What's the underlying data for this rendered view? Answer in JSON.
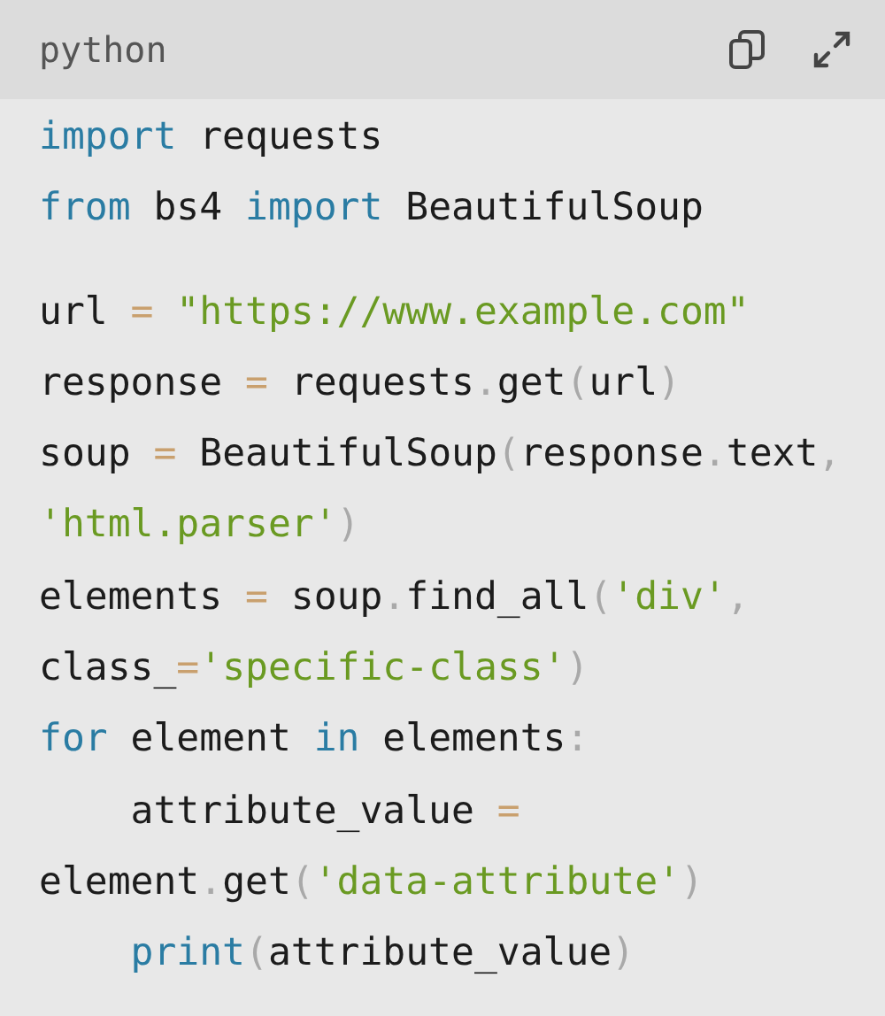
{
  "header": {
    "language": "python"
  },
  "code": {
    "blocks": [
      [
        [
          {
            "text": "import",
            "kind": "keyword"
          },
          {
            "text": " requests",
            "kind": "plain"
          }
        ],
        [
          {
            "text": "from",
            "kind": "keyword"
          },
          {
            "text": " bs4 ",
            "kind": "plain"
          },
          {
            "text": "import",
            "kind": "keyword"
          },
          {
            "text": " BeautifulSoup",
            "kind": "plain"
          }
        ]
      ],
      [
        [
          {
            "text": "url ",
            "kind": "plain"
          },
          {
            "text": "=",
            "kind": "operator"
          },
          {
            "text": " \"https://www.example.com\"",
            "kind": "string"
          }
        ],
        [
          {
            "text": "response ",
            "kind": "plain"
          },
          {
            "text": "=",
            "kind": "operator"
          },
          {
            "text": " requests",
            "kind": "plain"
          },
          {
            "text": ".",
            "kind": "punct"
          },
          {
            "text": "get",
            "kind": "plain"
          },
          {
            "text": "(",
            "kind": "punct"
          },
          {
            "text": "url",
            "kind": "plain"
          },
          {
            "text": ")",
            "kind": "punct"
          }
        ],
        [
          {
            "text": "soup ",
            "kind": "plain"
          },
          {
            "text": "=",
            "kind": "operator"
          },
          {
            "text": " BeautifulSoup",
            "kind": "plain"
          },
          {
            "text": "(",
            "kind": "punct"
          },
          {
            "text": "response",
            "kind": "plain"
          },
          {
            "text": ".",
            "kind": "punct"
          },
          {
            "text": "text",
            "kind": "plain"
          },
          {
            "text": ",",
            "kind": "punct"
          }
        ],
        [
          {
            "text": "'html.parser'",
            "kind": "string"
          },
          {
            "text": ")",
            "kind": "punct"
          }
        ],
        [
          {
            "text": "elements ",
            "kind": "plain"
          },
          {
            "text": "=",
            "kind": "operator"
          },
          {
            "text": " soup",
            "kind": "plain"
          },
          {
            "text": ".",
            "kind": "punct"
          },
          {
            "text": "find_all",
            "kind": "plain"
          },
          {
            "text": "(",
            "kind": "punct"
          },
          {
            "text": "'div'",
            "kind": "string"
          },
          {
            "text": ",",
            "kind": "punct"
          }
        ],
        [
          {
            "text": "class_",
            "kind": "plain"
          },
          {
            "text": "=",
            "kind": "operator"
          },
          {
            "text": "'specific-class'",
            "kind": "string"
          },
          {
            "text": ")",
            "kind": "punct"
          }
        ],
        [
          {
            "text": "for",
            "kind": "keyword"
          },
          {
            "text": " element ",
            "kind": "plain"
          },
          {
            "text": "in",
            "kind": "keyword"
          },
          {
            "text": " elements",
            "kind": "plain"
          },
          {
            "text": ":",
            "kind": "punct"
          }
        ],
        [
          {
            "text": "    attribute_value ",
            "kind": "plain"
          },
          {
            "text": "=",
            "kind": "operator"
          }
        ],
        [
          {
            "text": "element",
            "kind": "plain"
          },
          {
            "text": ".",
            "kind": "punct"
          },
          {
            "text": "get",
            "kind": "plain"
          },
          {
            "text": "(",
            "kind": "punct"
          },
          {
            "text": "'data-attribute'",
            "kind": "string"
          },
          {
            "text": ")",
            "kind": "punct"
          }
        ],
        [
          {
            "text": "    print",
            "kind": "keyword"
          },
          {
            "text": "(",
            "kind": "punct"
          },
          {
            "text": "attribute_value",
            "kind": "plain"
          },
          {
            "text": ")",
            "kind": "punct"
          }
        ]
      ]
    ]
  }
}
